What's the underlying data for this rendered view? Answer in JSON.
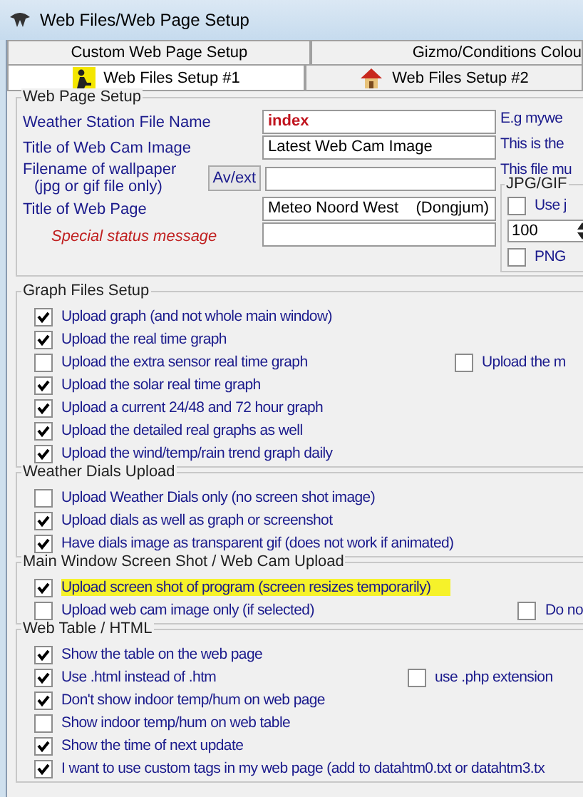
{
  "window": {
    "title": "Web Files/Web Page Setup"
  },
  "tab_rows": [
    {
      "tabs": [
        {
          "label": "Custom Web Page Setup",
          "selected": false
        },
        {
          "label": "Gizmo/Conditions Colou",
          "selected": false
        }
      ]
    },
    {
      "tabs": [
        {
          "label": "Web Files Setup #1",
          "selected": true,
          "kind": "person"
        },
        {
          "label": "Web Files Setup #2",
          "selected": false,
          "kind": "house"
        }
      ]
    }
  ],
  "web_page_setup": {
    "title": "Web Page Setup",
    "fields": [
      {
        "label": "Weather Station File Name",
        "value": "index",
        "emphasis": true
      },
      {
        "label": "Title of Web Cam Image",
        "value": "Latest Web Cam Image"
      },
      {
        "label": "Filename of wallpaper",
        "note": "(jpg or gif file only)",
        "button": "Av/ext"
      },
      {
        "label": "Title of Web Page",
        "value": "Meteo Noord West    (Dongjum)"
      },
      {
        "label": "Special status message",
        "kind": "status"
      }
    ],
    "hints": [
      "E.g mywe",
      "This is the",
      "This file mu"
    ],
    "image_group": {
      "title": "JPG/GIF",
      "use": {
        "label": "Use j",
        "checked": false
      },
      "quality": "100",
      "png": {
        "label": "PNG",
        "checked": false
      }
    }
  },
  "sections": [
    {
      "title": "Graph Files Setup",
      "items": [
        {
          "label": "Upload graph (and not whole main window)",
          "checked": true
        },
        {
          "label": "Upload the real time graph",
          "checked": true
        },
        {
          "label": "Upload the extra sensor real time graph",
          "checked": false,
          "side": {
            "label": "Upload the m",
            "checked": false
          }
        },
        {
          "label": "Upload the solar real time graph",
          "checked": true
        },
        {
          "label": "Upload a current 24/48 and 72 hour graph",
          "checked": true
        },
        {
          "label": "Upload the detailed real graphs as well",
          "checked": true
        },
        {
          "label": "Upload the wind/temp/rain trend graph daily",
          "checked": true
        }
      ]
    },
    {
      "title": "Weather Dials Upload",
      "items": [
        {
          "label": "Upload Weather Dials only (no screen shot image)",
          "checked": false
        },
        {
          "label": "Upload dials as well as graph or screenshot",
          "checked": true
        },
        {
          "label": "Have dials image as transparent gif (does not work if animated)",
          "checked": true
        }
      ]
    },
    {
      "title": "Main Window Screen Shot / Web Cam Upload",
      "items": [
        {
          "label": "Upload screen shot of program (screen resizes temporarily)",
          "checked": true,
          "highlighted": true
        },
        {
          "label": "Upload web cam image only (if selected)",
          "checked": false,
          "side": {
            "label": "Do no",
            "checked": false
          }
        }
      ]
    },
    {
      "title": "Web Table / HTML",
      "items": [
        {
          "label": "Show the table on the web page",
          "checked": true
        },
        {
          "label": "Use .html instead of .htm",
          "checked": true,
          "side": {
            "label": "use .php extension",
            "checked": false
          }
        },
        {
          "label": "Don't show indoor temp/hum on web page",
          "checked": true
        },
        {
          "label": "Show indoor temp/hum on web table",
          "checked": false
        },
        {
          "label": "Show the time of next update",
          "checked": true
        },
        {
          "label": "I want to use custom tags in my web page (add to datahtm0.txt or datahtm3.tx",
          "checked": true
        }
      ]
    }
  ]
}
